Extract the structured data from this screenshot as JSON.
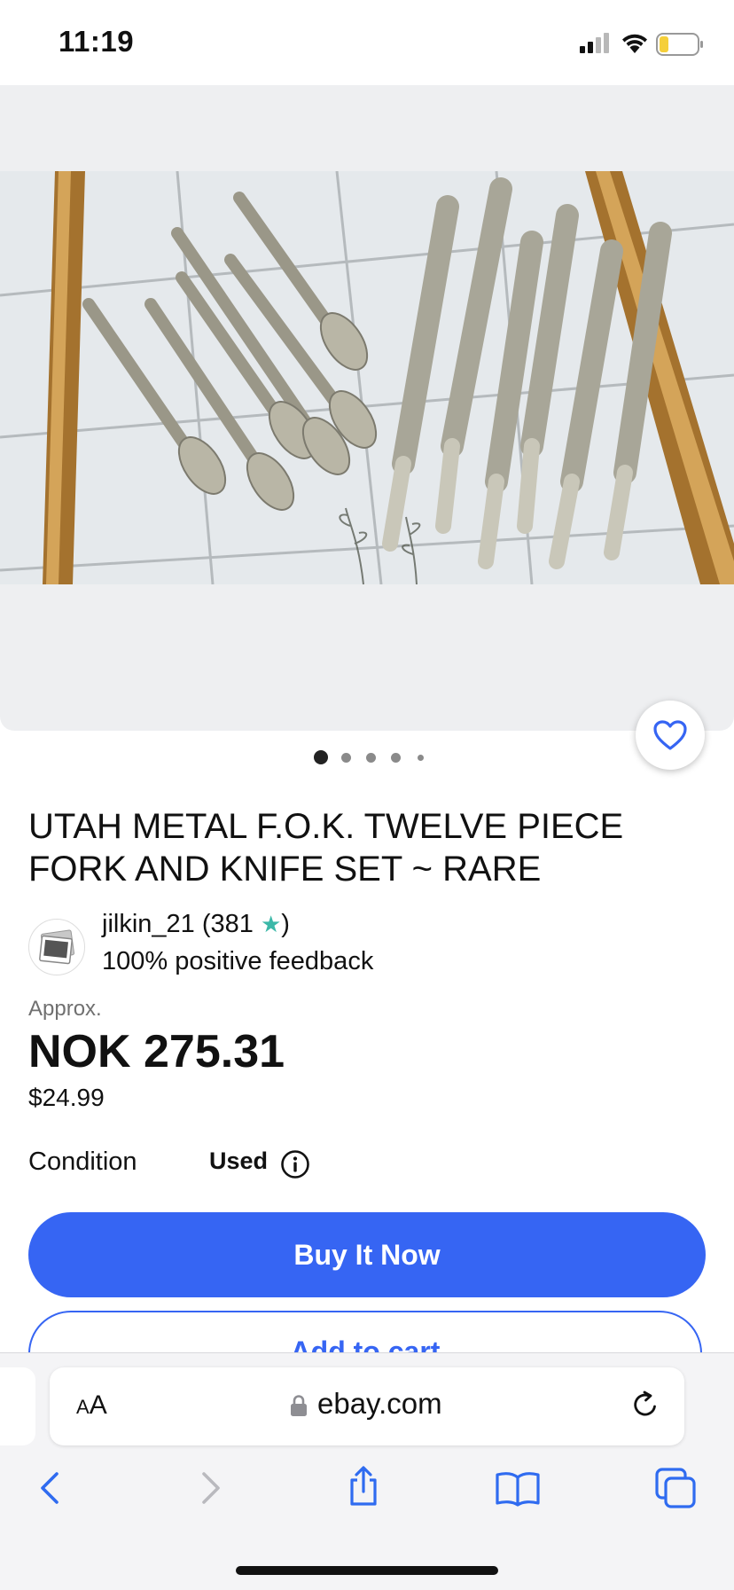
{
  "status_bar": {
    "time": "11:19",
    "icons": [
      "signal-icon",
      "wifi-icon",
      "battery-icon"
    ],
    "battery_color": "#f5cf3a"
  },
  "gallery": {
    "image_alt": "Forks and knives laid on white tiles",
    "page_dot_count": 5,
    "active_dot": 1,
    "wishlist_icon": "heart-icon"
  },
  "listing": {
    "title": "UTAH METAL F.O.K. TWELVE PIECE FORK AND KNIFE SET ~ RARE",
    "seller": {
      "name": "jilkin_21",
      "score_open": " (381 ",
      "star": "★",
      "score_close": ")",
      "feedback": "100% positive feedback"
    },
    "price": {
      "approx_label": "Approx.",
      "converted": "NOK 275.31",
      "original": "$24.99"
    },
    "condition": {
      "label": "Condition",
      "value": "Used",
      "info_icon": "info-icon"
    },
    "buttons": {
      "buy_now": "Buy It Now",
      "add_to_cart": "Add to cart"
    }
  },
  "browser": {
    "text_size_label_small": "A",
    "text_size_label_large": "A",
    "url": "ebay.com",
    "toolbar": [
      "back-icon",
      "forward-icon",
      "share-icon",
      "bookmarks-icon",
      "tabs-icon"
    ]
  },
  "colors": {
    "accent": "#3665f3",
    "ios_blue": "#2f6bf0",
    "text": "#111111",
    "muted": "#707070"
  }
}
